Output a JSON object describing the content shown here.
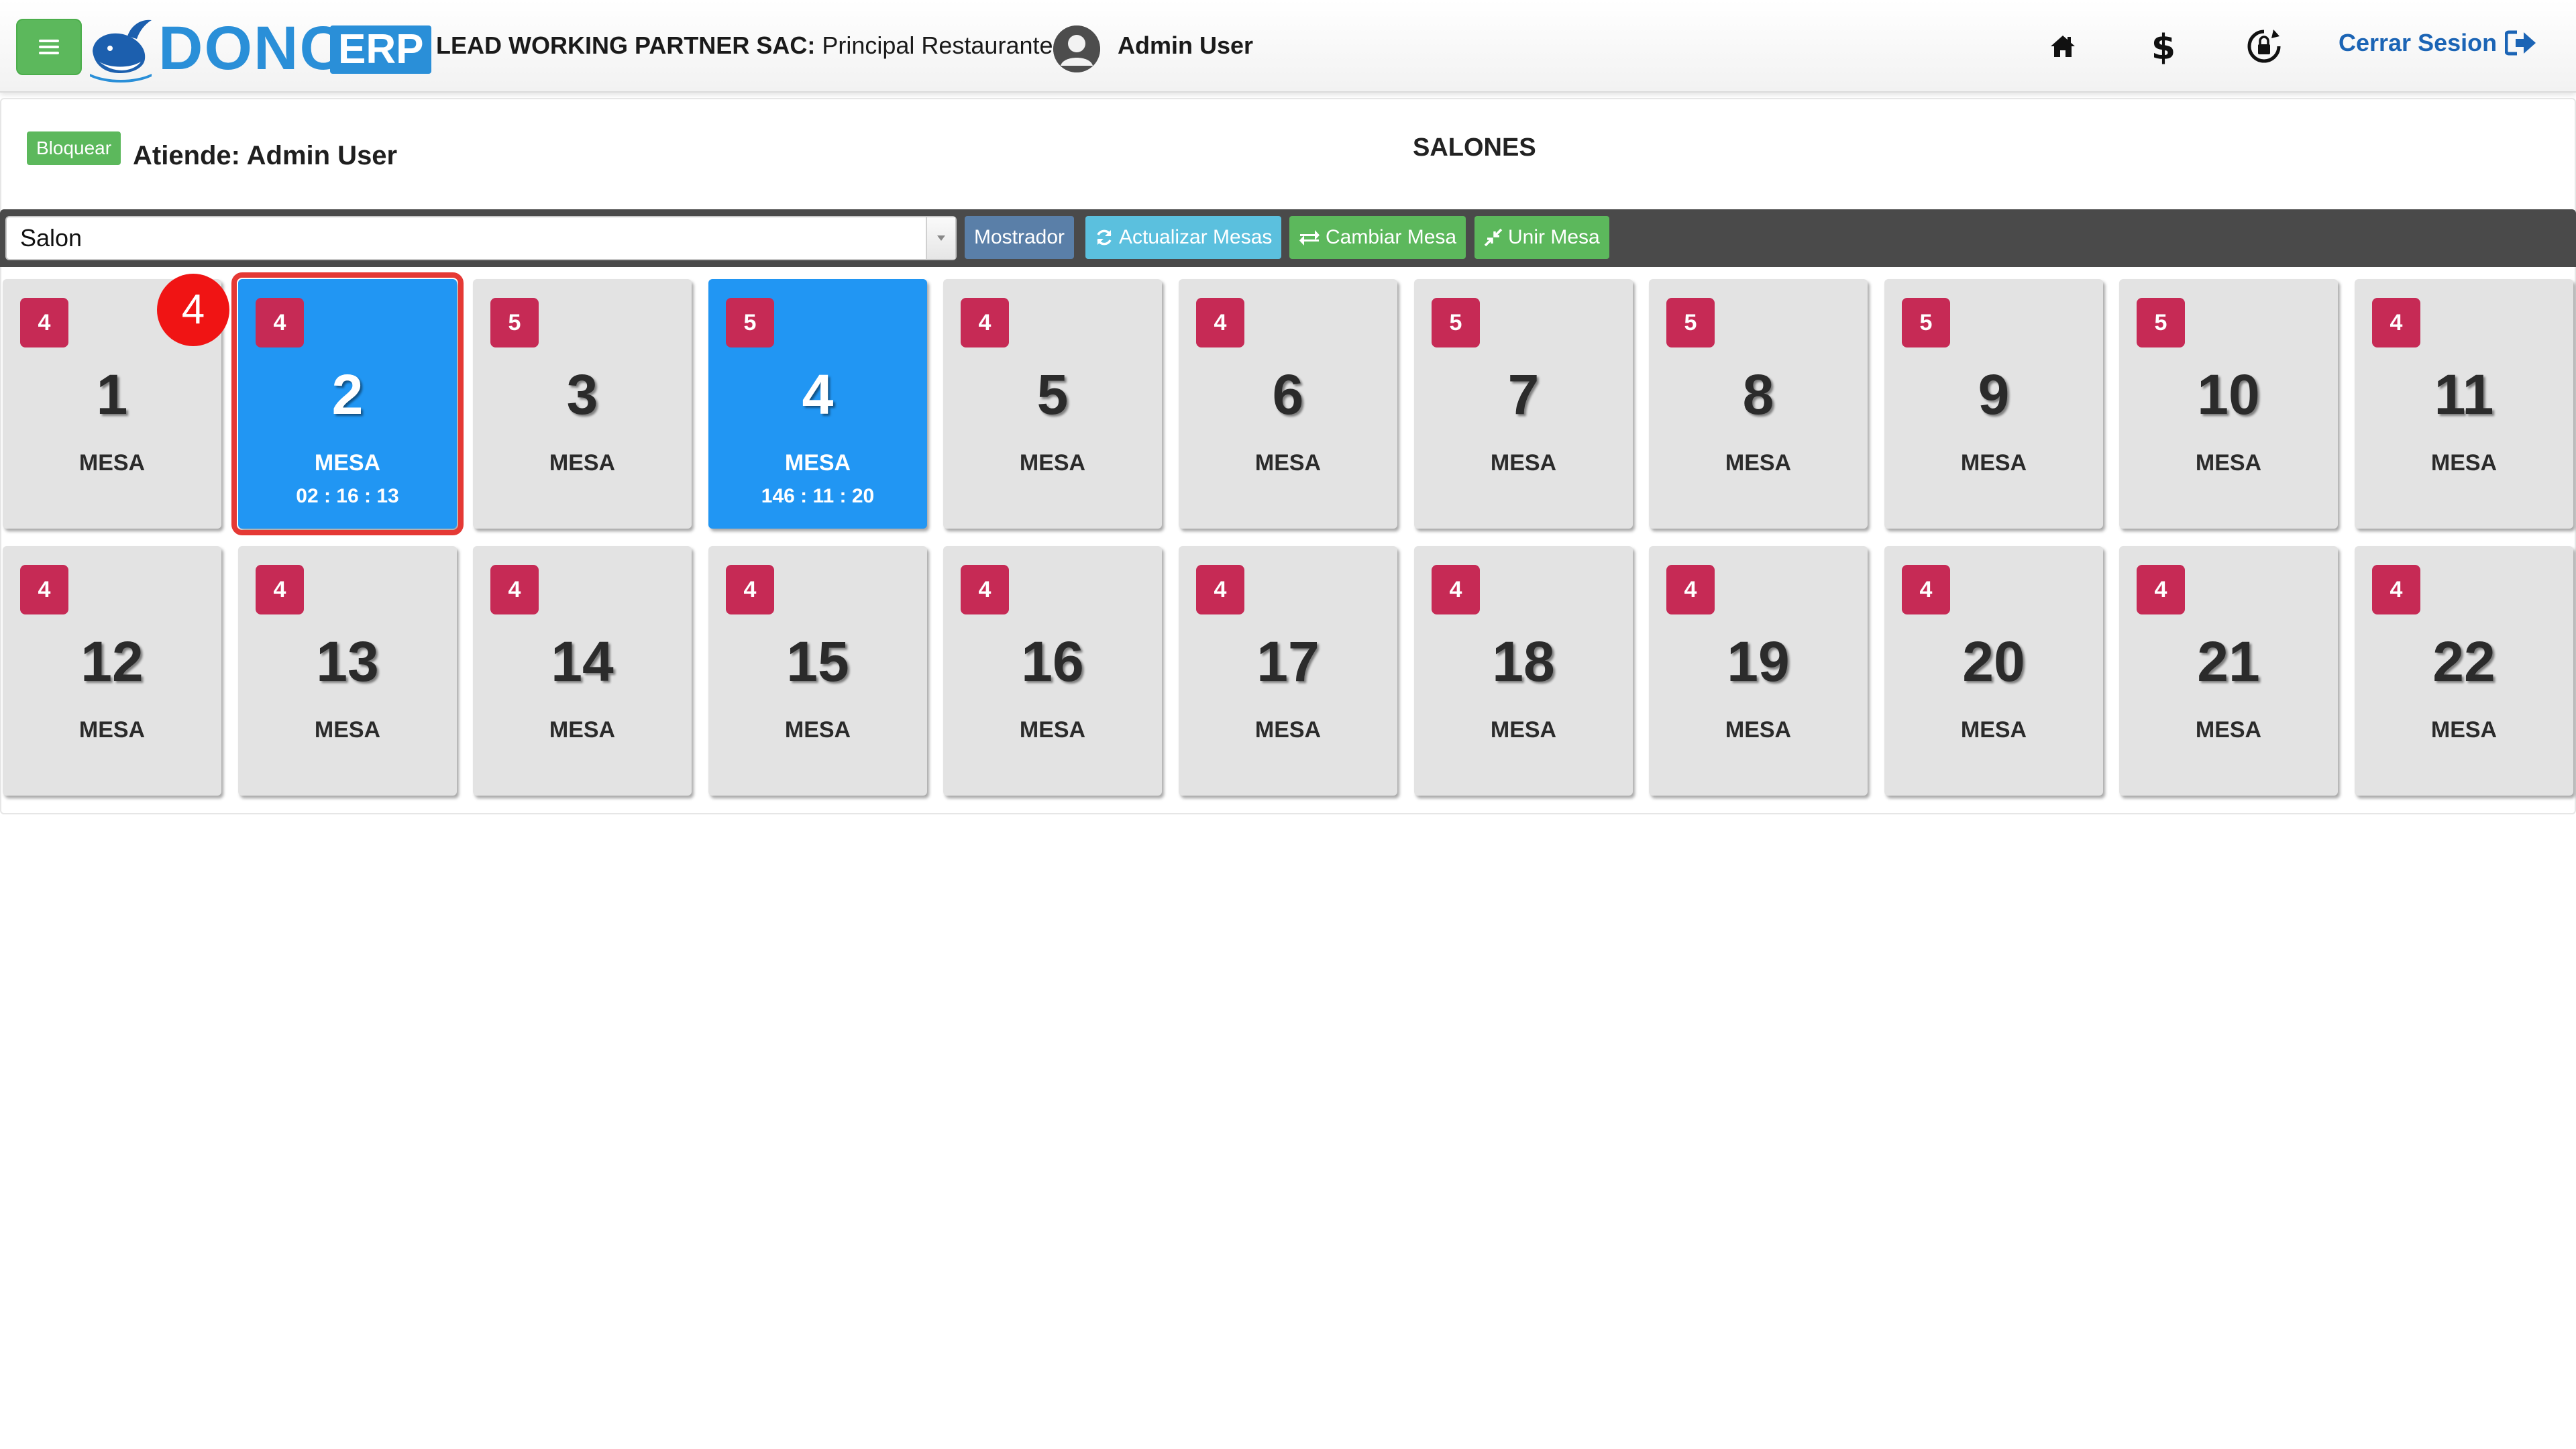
{
  "header": {
    "logo_text": "DONCA",
    "logo_badge": "ERP",
    "company_name": "LEAD WORKING PARTNER SAC:",
    "branch": "Principal Restaurante |",
    "user_name": "Admin User",
    "logout_label": "Cerrar Sesion",
    "icons": [
      "menu-icon",
      "home-icon",
      "dollar-icon",
      "lock-rotate-icon",
      "sign-out-icon"
    ]
  },
  "panel": {
    "lock_label": "Bloquear",
    "attends_label": "Atiende: Admin User",
    "title": "SALONES"
  },
  "toolbar": {
    "salon_selected": "Salon",
    "mostrador_label": "Mostrador",
    "refresh_label": "Actualizar Mesas",
    "change_label": "Cambiar Mesa",
    "join_label": "Unir Mesa"
  },
  "step_marker": "4",
  "tables": [
    {
      "number": "1",
      "label": "MESA",
      "seats": "4",
      "timer": "",
      "active": false,
      "selected": false
    },
    {
      "number": "2",
      "label": "MESA",
      "seats": "4",
      "timer": "02 : 16 : 13",
      "active": true,
      "selected": true
    },
    {
      "number": "3",
      "label": "MESA",
      "seats": "5",
      "timer": "",
      "active": false,
      "selected": false
    },
    {
      "number": "4",
      "label": "MESA",
      "seats": "5",
      "timer": "146 : 11 : 20",
      "active": true,
      "selected": false
    },
    {
      "number": "5",
      "label": "MESA",
      "seats": "4",
      "timer": "",
      "active": false,
      "selected": false
    },
    {
      "number": "6",
      "label": "MESA",
      "seats": "4",
      "timer": "",
      "active": false,
      "selected": false
    },
    {
      "number": "7",
      "label": "MESA",
      "seats": "5",
      "timer": "",
      "active": false,
      "selected": false
    },
    {
      "number": "8",
      "label": "MESA",
      "seats": "5",
      "timer": "",
      "active": false,
      "selected": false
    },
    {
      "number": "9",
      "label": "MESA",
      "seats": "5",
      "timer": "",
      "active": false,
      "selected": false
    },
    {
      "number": "10",
      "label": "MESA",
      "seats": "5",
      "timer": "",
      "active": false,
      "selected": false
    },
    {
      "number": "11",
      "label": "MESA",
      "seats": "4",
      "timer": "",
      "active": false,
      "selected": false
    },
    {
      "number": "12",
      "label": "MESA",
      "seats": "4",
      "timer": "",
      "active": false,
      "selected": false
    },
    {
      "number": "13",
      "label": "MESA",
      "seats": "4",
      "timer": "",
      "active": false,
      "selected": false
    },
    {
      "number": "14",
      "label": "MESA",
      "seats": "4",
      "timer": "",
      "active": false,
      "selected": false
    },
    {
      "number": "15",
      "label": "MESA",
      "seats": "4",
      "timer": "",
      "active": false,
      "selected": false
    },
    {
      "number": "16",
      "label": "MESA",
      "seats": "4",
      "timer": "",
      "active": false,
      "selected": false
    },
    {
      "number": "17",
      "label": "MESA",
      "seats": "4",
      "timer": "",
      "active": false,
      "selected": false
    },
    {
      "number": "18",
      "label": "MESA",
      "seats": "4",
      "timer": "",
      "active": false,
      "selected": false
    },
    {
      "number": "19",
      "label": "MESA",
      "seats": "4",
      "timer": "",
      "active": false,
      "selected": false
    },
    {
      "number": "20",
      "label": "MESA",
      "seats": "4",
      "timer": "",
      "active": false,
      "selected": false
    },
    {
      "number": "21",
      "label": "MESA",
      "seats": "4",
      "timer": "",
      "active": false,
      "selected": false
    },
    {
      "number": "22",
      "label": "MESA",
      "seats": "4",
      "timer": "",
      "active": false,
      "selected": false
    }
  ],
  "colors": {
    "accent_green": "#5cb85c",
    "accent_blue": "#2196f3",
    "badge_red": "#c62a55",
    "logout_blue": "#1b64b5",
    "toolbar_dark": "#4a4a4a",
    "selection_red": "#e53935"
  }
}
